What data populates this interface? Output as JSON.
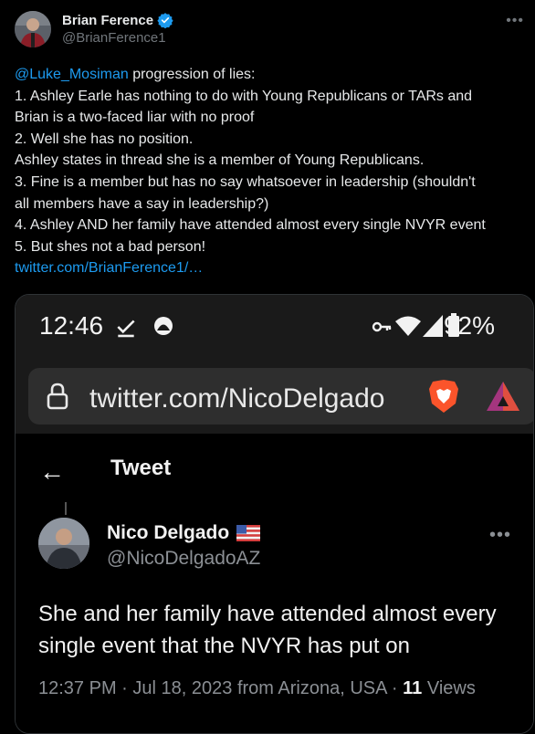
{
  "author": {
    "name": "Brian Ference",
    "handle": "@BrianFerence1",
    "verified_color": "#1d9bf0"
  },
  "tweet": {
    "mention": "@Luke_Mosiman",
    "lines": [
      " progression of lies:",
      "1. Ashley Earle has nothing to do with Young Republicans or TARs and",
      "Brian is a two-faced liar with no proof",
      "2. Well she has no position.",
      "Ashley states in thread she is a member of Young Republicans.",
      "3. Fine is a member but has no say whatsoever in leadership (shouldn't",
      "all members have a say in leadership?)",
      "4. Ashley AND her family have attended almost every single NVYR event",
      "5. But shes not a bad person!"
    ],
    "link": "twitter.com/BrianFerence1/…",
    "link_color": "#1d9bf0"
  },
  "screenshot": {
    "status_bar": {
      "time": "12:46",
      "battery": "92%"
    },
    "browser": {
      "url": "twitter.com/NicoDelgado"
    },
    "page": {
      "title": "Tweet",
      "author_name": "Nico Delgado",
      "author_handle": "@NicoDelgadoAZ",
      "text_lines": [
        "She and her family have attended almost every",
        "single event that the NVYR has put on"
      ],
      "meta": {
        "time": "12:37 PM",
        "date": "Jul 18, 2023",
        "location": "from Arizona, USA",
        "views_count": "11",
        "views_label": "Views"
      }
    }
  }
}
